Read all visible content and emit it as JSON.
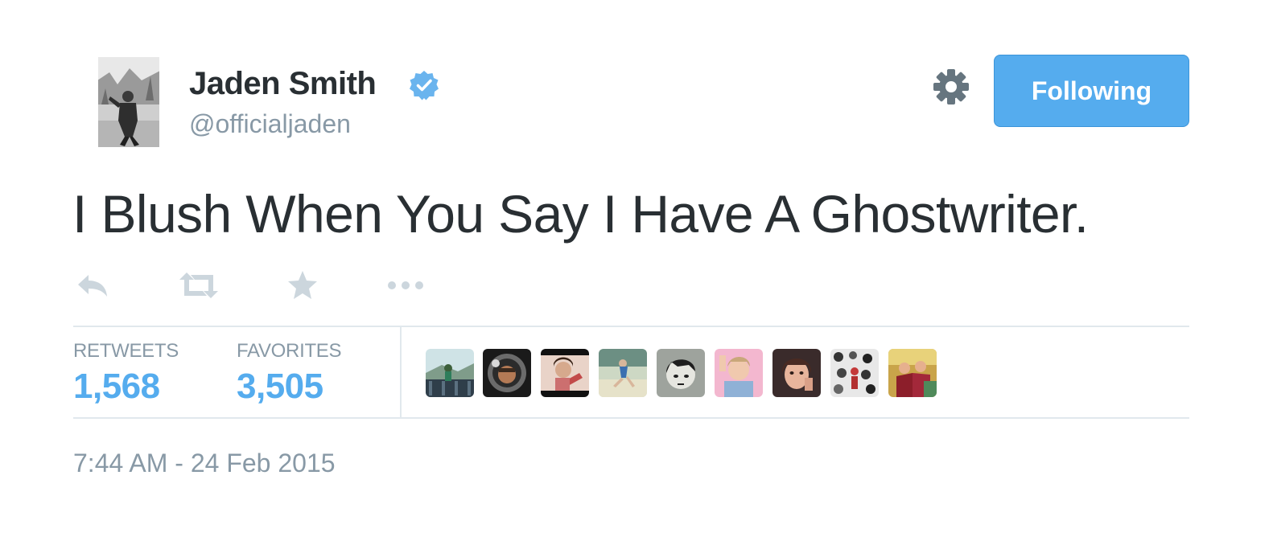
{
  "user": {
    "name": "Jaden Smith",
    "handle": "@officialjaden",
    "avatar_icon": "profile-photo",
    "verified_icon": "verified-badge-icon"
  },
  "header": {
    "settings_icon": "gear-icon",
    "follow_button_label": "Following"
  },
  "tweet": {
    "text": "I Blush When You Say I Have A Ghostwriter.",
    "timestamp": "7:44 AM - 24 Feb 2015"
  },
  "actions": [
    {
      "icon": "reply-icon"
    },
    {
      "icon": "retweet-icon"
    },
    {
      "icon": "favorite-star-icon"
    },
    {
      "icon": "more-dots-icon"
    }
  ],
  "stats": {
    "retweets_label": "RETWEETS",
    "retweets_count": "1,568",
    "favorites_label": "FAVORITES",
    "favorites_count": "3,505"
  },
  "favoriters_count_shown": 9,
  "colors": {
    "accent": "#55acee",
    "text": "#292f33",
    "muted": "#8899a6",
    "action_icon": "#ccd6dd",
    "divider": "#e1e8ed"
  }
}
